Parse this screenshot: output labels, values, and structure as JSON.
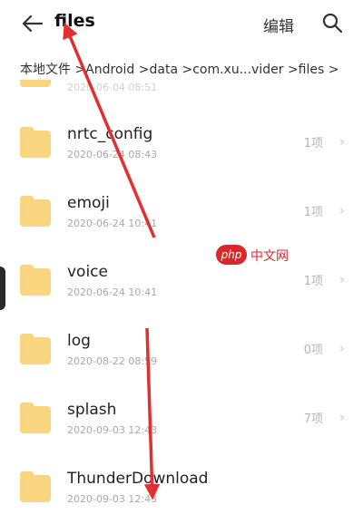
{
  "header": {
    "title": "files",
    "edit_label": "编辑",
    "back_icon": "back-arrow-icon",
    "search_icon": "search-icon"
  },
  "breadcrumb": "本地文件 >Android >data >com.xu...vider >files >",
  "partial_row": {
    "date": "2020-06-04 08:51"
  },
  "files": [
    {
      "name": "nrtc_config",
      "date": "2020-06-24 08:43",
      "count": "1项"
    },
    {
      "name": "emoji",
      "date": "2020-06-24 10:41",
      "count": "1项"
    },
    {
      "name": "voice",
      "date": "2020-06-24 10:41",
      "count": "1项"
    },
    {
      "name": "log",
      "date": "2020-08-22 08:59",
      "count": "0项"
    },
    {
      "name": "splash",
      "date": "2020-09-03 12:43",
      "count": "7项"
    },
    {
      "name": "ThunderDownload",
      "date": "2020-09-03 12:43",
      "count": ""
    }
  ],
  "watermark": {
    "logo": "php",
    "text": "中文网"
  },
  "colors": {
    "folder": "#f9d67f",
    "arrow": "#e03030"
  }
}
